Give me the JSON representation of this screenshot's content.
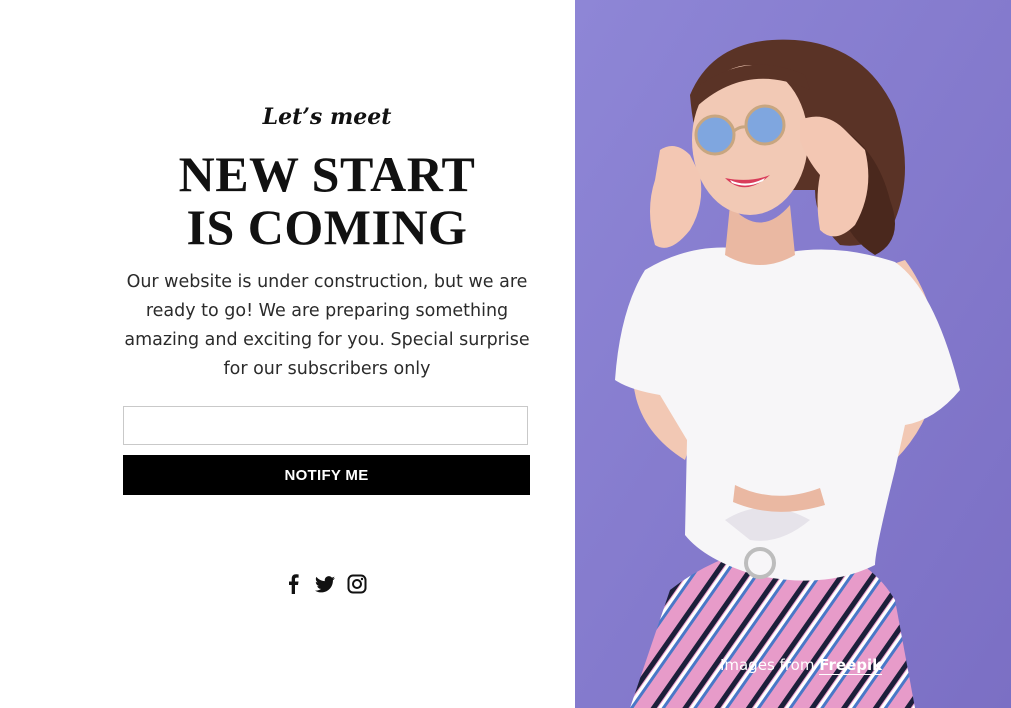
{
  "hero": {
    "eyebrow": "Let’s meet",
    "headline_line1": "NEW START",
    "headline_line2": "IS COMING",
    "description": "Our website is under construction, but we are ready to go! We are preparing something amazing and exciting for you. Special surprise for our subscribers only"
  },
  "form": {
    "email_value": "",
    "email_placeholder": "",
    "notify_label": "NOTIFY ME"
  },
  "social": {
    "icons": [
      "facebook-icon",
      "twitter-icon",
      "instagram-icon"
    ]
  },
  "photo": {
    "credit_prefix": "Images from",
    "credit_link": "Freepik"
  },
  "colors": {
    "background_left": "#ffffff",
    "background_right": "#8a7fd0",
    "button": "#000000",
    "text": "#111111"
  }
}
